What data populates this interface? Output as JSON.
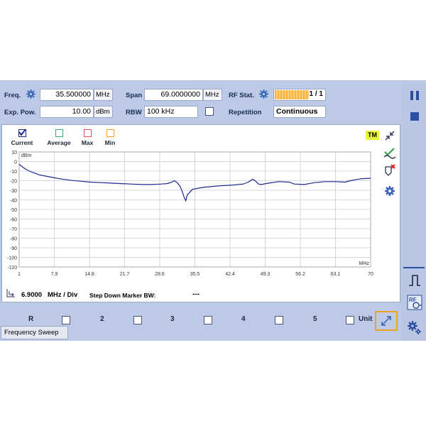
{
  "params": {
    "freq": {
      "label": "Freq.",
      "value": "35.500000",
      "unit": "MHz"
    },
    "span": {
      "label": "Span",
      "value": "69.0000000",
      "unit": "MHz"
    },
    "rf_stat": {
      "label": "RF Stat.",
      "value": "1 / 1",
      "progress": 1.0
    },
    "exp_pow": {
      "label": "Exp. Pow.",
      "value": "10.00",
      "unit": "dBm"
    },
    "rbw": {
      "label": "RBW",
      "value": "100 kHz"
    },
    "repetition": {
      "label": "Repetition",
      "value": "Continuous"
    }
  },
  "traces": [
    {
      "label": "Current",
      "checked": true,
      "color": "#1b2a8f"
    },
    {
      "label": "Average",
      "checked": false,
      "color": "#3aa37a"
    },
    {
      "label": "Max",
      "checked": false,
      "color": "#e0505a"
    },
    {
      "label": "Min",
      "checked": false,
      "color": "#f0a020"
    }
  ],
  "tm_badge": "TM",
  "scale": {
    "value": "6.9000",
    "unit": "MHz / Div"
  },
  "marker_bw": {
    "label": "Step Down Marker BW:",
    "value": "---"
  },
  "markers": [
    "R",
    "2",
    "3",
    "4",
    "5",
    "Unit"
  ],
  "tab_label": "Frequency Sweep",
  "colors": {
    "accent": "#f0a020",
    "trace": "#1b2a8f",
    "panel": "#bccae7"
  },
  "chart_data": {
    "type": "line",
    "ylabel": "dBm",
    "xlabel": "MHz",
    "xlim": [
      1,
      70
    ],
    "ylim": [
      -110,
      10
    ],
    "x_ticks": [
      "1",
      "7.9",
      "14.8",
      "21.7",
      "28.6",
      "35.5",
      "42.4",
      "49.3",
      "56.2",
      "63.1",
      "70"
    ],
    "y_ticks": [
      "10",
      "0",
      "-10",
      "-20",
      "-30",
      "-40",
      "-50",
      "-60",
      "-70",
      "-80",
      "-90",
      "-100",
      "-110"
    ],
    "grid": true,
    "series": [
      {
        "x": [
          1,
          2,
          3,
          4,
          5,
          7,
          9,
          11,
          13,
          15,
          17,
          19,
          21,
          23,
          25,
          27,
          29,
          30,
          31,
          31.5,
          32,
          32.5,
          33,
          33.3,
          33.7,
          34,
          35,
          37,
          40,
          43,
          45,
          46,
          46.8,
          47.3,
          48,
          48.5,
          50,
          52,
          54,
          55,
          57,
          59,
          61,
          63,
          65,
          66,
          68,
          70
        ],
        "y": [
          -3,
          -7,
          -10,
          -12,
          -14,
          -16,
          -18,
          -19.5,
          -20.5,
          -21.5,
          -22,
          -22.5,
          -23,
          -23.5,
          -24,
          -24,
          -23.5,
          -23,
          -21.5,
          -20,
          -22,
          -25,
          -31,
          -36,
          -41,
          -35,
          -29,
          -27,
          -25.5,
          -24.5,
          -23.5,
          -21.5,
          -18.5,
          -20,
          -23.5,
          -24,
          -22.5,
          -21,
          -21.5,
          -23.5,
          -24,
          -22,
          -21,
          -21,
          -21.5,
          -20,
          -18,
          -17.5
        ]
      }
    ]
  }
}
